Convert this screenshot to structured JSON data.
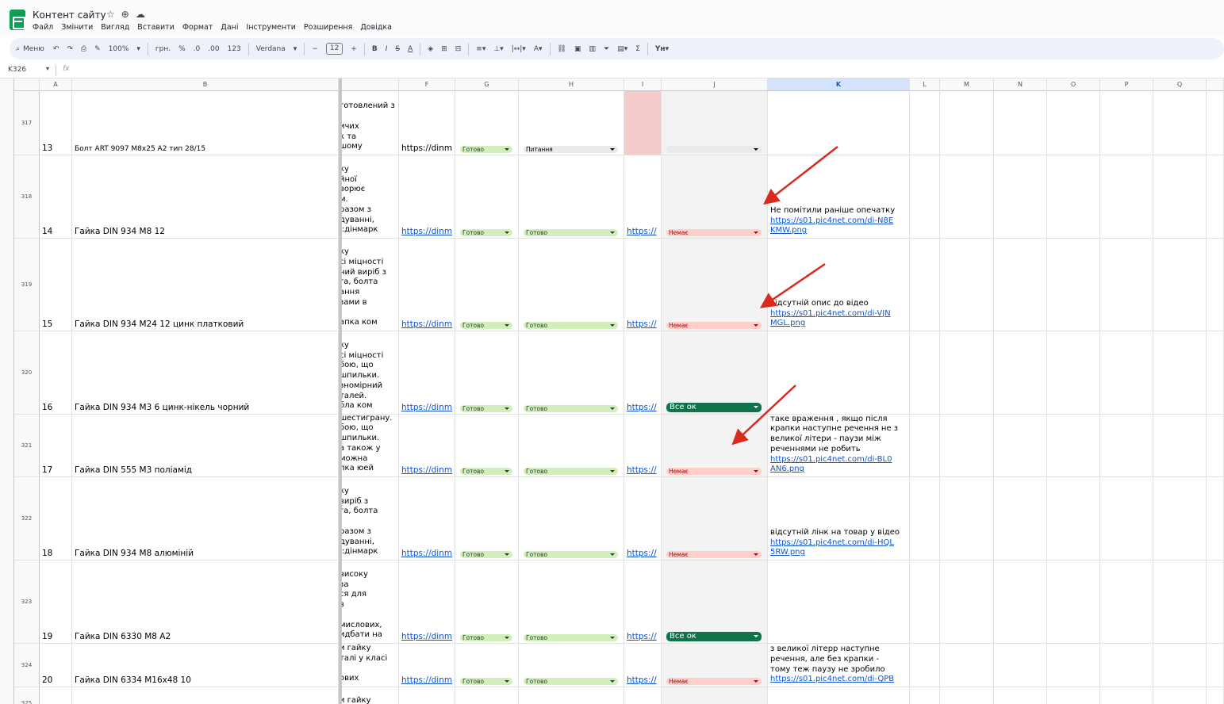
{
  "app": {
    "title": "Контент сайту",
    "star_icon": "star-icon",
    "move_icon": "move-icon",
    "cloud_icon": "cloud-icon"
  },
  "menu": [
    "Файл",
    "Змінити",
    "Вигляд",
    "Вставити",
    "Формат",
    "Дані",
    "Інструменти",
    "Розширення",
    "Довідка"
  ],
  "toolbar": {
    "search": "Меню",
    "zoom": "100%",
    "currency": "грн.",
    "percent": "%",
    "dec_less": ".0",
    "dec_more": ".00",
    "format_123": "123",
    "font": "Verdana",
    "font_size": "12",
    "bold": "B",
    "italic": "I",
    "strike": "S",
    "text_color": "A",
    "function_icon": "Σ"
  },
  "formula_bar": {
    "cell_ref": "K326",
    "fx": "fx"
  },
  "columns": [
    "A",
    "B",
    "F",
    "G",
    "H",
    "I",
    "J",
    "K",
    "L",
    "M",
    "N",
    "O",
    "P",
    "Q"
  ],
  "rows": [
    {
      "num": "317",
      "a": "13",
      "b": "Болт ART 9097 M8x25 A2 тип 28/15",
      "desc": "готовлений з\n\nичих\nк та\nшому",
      "f": "https://dinm",
      "g": "Готово",
      "h": "Питання",
      "i": "",
      "j": "",
      "k": []
    },
    {
      "num": "318",
      "a": "14",
      "b": "Гайка DIN 934 M8 12",
      "desc": "ку\nйної\nворює\nм.\nразом з\nдуванні,\nі:дінмарк",
      "f": "https://dinm",
      "g": "Готово",
      "h": "Готово",
      "i": "https://",
      "j": "Немає",
      "k": [
        "Не помітили раніше опечатку",
        "https://s01.pic4net.com/di-N8E",
        "KMW.png"
      ]
    },
    {
      "num": "319",
      "a": "15",
      "b": "Гайка DIN 934 M24 12 цинк платковий",
      "desc": "ку\nсі міцності\nний виріб з\nга, болта\nання\nзами в\n\nапка ком",
      "f": "https://dinm",
      "g": "Готово",
      "h": "Готово",
      "i": "https://",
      "j": "Немає",
      "k": [
        "відсутній опис до відео",
        "https://s01.pic4net.com/di-VJN",
        "MGL.png"
      ]
    },
    {
      "num": "320",
      "a": "16",
      "b": "Гайка DIN 934 M3 6 цинк-нікель чорний",
      "desc": "ку\nсі міцності\nбою, що\nшпильки.\nзномірний\nталей.\nбла ком",
      "f": "https://dinm",
      "g": "Готово",
      "h": "Готово",
      "i": "https://",
      "j": "Все ок",
      "k": []
    },
    {
      "num": "321",
      "a": "17",
      "b": "Гайка DIN 555 M3 поліамід",
      "desc": "шестиграну.\nбою, що\nшпильки.\nа також у\nможна\nпка юей",
      "f": "https://dinm",
      "g": "Готово",
      "h": "Готово",
      "i": "https://",
      "j": "Немає",
      "k": [
        "таке враження , якщо після",
        "крапки наступне речення не з",
        "великої літери - паузи між",
        "реченнями не робить",
        "https://s01.pic4net.com/di-BL0",
        "AN6.png"
      ]
    },
    {
      "num": "322",
      "a": "18",
      "b": "Гайка DIN 934 M8 алюміній",
      "desc": "ку\nвиріб з\nга, болта\n\nразом з\nдуванні,\nі:дінмарк",
      "f": "https://dinm",
      "g": "Готово",
      "h": "Готово",
      "i": "https://",
      "j": "Немає",
      "k": [
        "відсутній лінк на товар у відео",
        "https://s01.pic4net.com/di-HQL",
        "5RW.png"
      ]
    },
    {
      "num": "323",
      "a": "19",
      "b": "Гайка DIN 6330 M8 A2",
      "desc": "високу\nза\nся для\nв\n\nмислових,\nидбати на",
      "f": "https://dinm",
      "g": "Готово",
      "h": "Готово",
      "i": "https://",
      "j": "Все ок",
      "k": []
    },
    {
      "num": "324",
      "a": "20",
      "b": "Гайка DIN 6334 M16x48 10",
      "desc": "и гайку\nталі у класі\n\nових",
      "f": "https://dinm",
      "g": "Готово",
      "h": "Готово",
      "i": "https://",
      "j": "Немає",
      "k": [
        "з великої літерр наступне",
        "речення, але без крапки -",
        "тому теж паузу не зробило",
        "https://s01.pic4net.com/di-QPB"
      ]
    },
    {
      "num": "325",
      "a": "",
      "b": "",
      "desc": "и гайку\nталі А два",
      "f": "",
      "g": "",
      "h": "",
      "i": "",
      "j": "",
      "k": []
    }
  ],
  "colors": {
    "chip_green": "#d4edbc",
    "chip_red": "#ffcfc9",
    "chip_dark": "#11734b",
    "arrow": "#d92a1e",
    "pink_cell": "#f4cccc",
    "gray_col": "#f3f3f3"
  }
}
